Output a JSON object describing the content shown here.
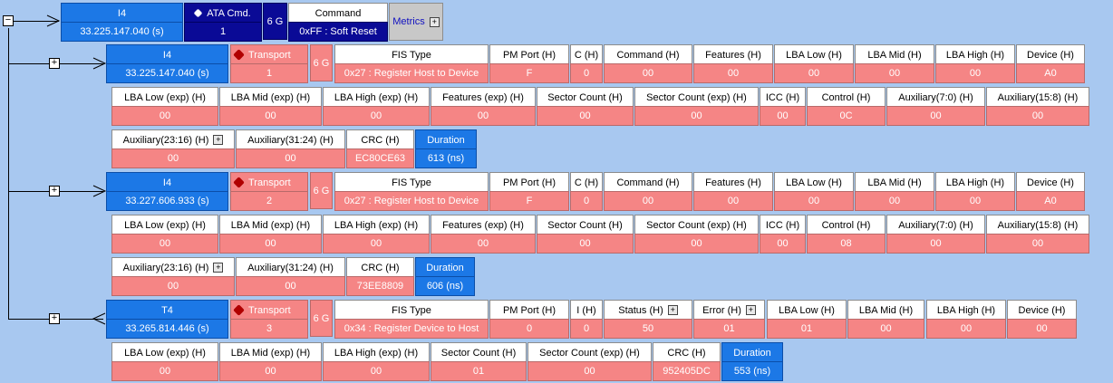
{
  "command_row": {
    "id_label": "I4",
    "timestamp": "33.225.147.040 (s)",
    "ata_label": "ATA Cmd.",
    "ata_value": "1",
    "speed": "6 G",
    "command_label": "Command",
    "command_value": "0xFF : Soft Reset",
    "metrics_label": "Metrics"
  },
  "fis_rows": [
    {
      "id_label": "I4",
      "timestamp": "33.225.147.040 (s)",
      "transport_label": "Transport",
      "transport_value": "1",
      "speed": "6 G",
      "r1": [
        [
          "FIS Type",
          "0x27 : Register Host to Device"
        ],
        [
          "PM Port (H)",
          "F"
        ],
        [
          "C (H)",
          "0"
        ],
        [
          "Command (H)",
          "00"
        ],
        [
          "Features (H)",
          "00"
        ],
        [
          "LBA Low (H)",
          "00"
        ],
        [
          "LBA Mid (H)",
          "00"
        ],
        [
          "LBA High (H)",
          "00"
        ],
        [
          "Device (H)",
          "A0"
        ]
      ],
      "r2": [
        [
          "LBA Low (exp) (H)",
          "00"
        ],
        [
          "LBA Mid (exp) (H)",
          "00"
        ],
        [
          "LBA High (exp) (H)",
          "00"
        ],
        [
          "Features (exp) (H)",
          "00"
        ],
        [
          "Sector Count (H)",
          "00"
        ],
        [
          "Sector Count (exp) (H)",
          "00"
        ],
        [
          "ICC (H)",
          "00"
        ],
        [
          "Control (H)",
          "0C"
        ],
        [
          "Auxiliary(7:0) (H)",
          "00"
        ],
        [
          "Auxiliary(15:8) (H)",
          "00"
        ]
      ],
      "r3": [
        [
          "Auxiliary(23:16) (H)",
          "00"
        ],
        [
          "Auxiliary(31:24) (H)",
          "00"
        ],
        [
          "CRC (H)",
          "EC80CE63"
        ],
        [
          "Duration",
          "613 (ns)"
        ]
      ]
    },
    {
      "id_label": "I4",
      "timestamp": "33.227.606.933 (s)",
      "transport_label": "Transport",
      "transport_value": "2",
      "speed": "6 G",
      "r1": [
        [
          "FIS Type",
          "0x27 : Register Host to Device"
        ],
        [
          "PM Port (H)",
          "F"
        ],
        [
          "C (H)",
          "0"
        ],
        [
          "Command (H)",
          "00"
        ],
        [
          "Features (H)",
          "00"
        ],
        [
          "LBA Low (H)",
          "00"
        ],
        [
          "LBA Mid (H)",
          "00"
        ],
        [
          "LBA High (H)",
          "00"
        ],
        [
          "Device (H)",
          "A0"
        ]
      ],
      "r2": [
        [
          "LBA Low (exp) (H)",
          "00"
        ],
        [
          "LBA Mid (exp) (H)",
          "00"
        ],
        [
          "LBA High (exp) (H)",
          "00"
        ],
        [
          "Features (exp) (H)",
          "00"
        ],
        [
          "Sector Count (H)",
          "00"
        ],
        [
          "Sector Count (exp) (H)",
          "00"
        ],
        [
          "ICC (H)",
          "00"
        ],
        [
          "Control (H)",
          "08"
        ],
        [
          "Auxiliary(7:0) (H)",
          "00"
        ],
        [
          "Auxiliary(15:8) (H)",
          "00"
        ]
      ],
      "r3": [
        [
          "Auxiliary(23:16) (H)",
          "00"
        ],
        [
          "Auxiliary(31:24) (H)",
          "00"
        ],
        [
          "CRC (H)",
          "73EE8809"
        ],
        [
          "Duration",
          "606 (ns)"
        ]
      ]
    },
    {
      "id_label": "T4",
      "timestamp": "33.265.814.446 (s)",
      "transport_label": "Transport",
      "transport_value": "3",
      "speed": "6 G",
      "r1": [
        [
          "FIS Type",
          "0x34 : Register Device to Host"
        ],
        [
          "PM Port (H)",
          "0"
        ],
        [
          "I (H)",
          "0"
        ],
        [
          "Status (H)",
          "50"
        ],
        [
          "Error (H)",
          "01"
        ],
        [
          "LBA Low (H)",
          "01"
        ],
        [
          "LBA Mid (H)",
          "00"
        ],
        [
          "LBA High (H)",
          "00"
        ],
        [
          "Device (H)",
          "00"
        ]
      ],
      "r2": [
        [
          "LBA Low (exp) (H)",
          "00"
        ],
        [
          "LBA Mid (exp) (H)",
          "00"
        ],
        [
          "LBA High (exp) (H)",
          "00"
        ],
        [
          "Sector Count (H)",
          "01"
        ],
        [
          "Sector Count (exp) (H)",
          "00"
        ],
        [
          "CRC (H)",
          "952405DC"
        ],
        [
          "Duration",
          "553 (ns)"
        ]
      ]
    }
  ],
  "colors": {
    "value_bg": "#f58585",
    "header_bg": "#ffffff",
    "blue": "#1c78e6",
    "navy": "#0a0a96",
    "background": "#a8c8f0"
  }
}
